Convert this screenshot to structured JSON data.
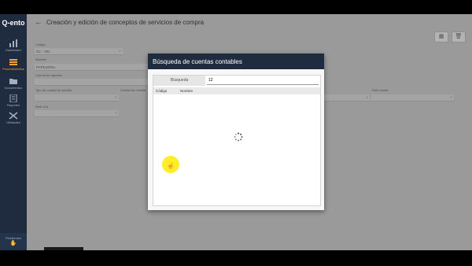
{
  "sidebar": {
    "logo": "Q-ento",
    "items": [
      {
        "label": "Dashboard",
        "icon": "bar-chart-icon",
        "active": false
      },
      {
        "label": "Procedimientos",
        "icon": "stack-icon",
        "active": true
      },
      {
        "label": "Documentos",
        "icon": "folder-icon",
        "active": false
      },
      {
        "label": "Reportes",
        "icon": "report-icon",
        "active": false
      },
      {
        "label": "Utilidades",
        "icon": "tools-icon",
        "active": false
      }
    ],
    "bottom_label": "Pendientes"
  },
  "header": {
    "title": "Creación y edición de conceptos de servicios de compra",
    "back_icon": "back-arrow-icon"
  },
  "form": {
    "codigo_label": "Código",
    "codigo_value": "SC - 001",
    "nombre_label": "Nombre",
    "nombre_value": "PAPELERIA",
    "cuenta_label": "Cuenta de egresos",
    "tipo_label": "Tipo de unidad de medida",
    "unidad_label": "Unidad de medida",
    "rete_fuente_label": "Rete fuente",
    "rete_ica_label": "Rete ICA"
  },
  "dialog": {
    "title": "Búsqueda de cuentas contables",
    "search_label": "Búsqueda",
    "search_value": "12",
    "columns": [
      "Código",
      "Nombre"
    ]
  },
  "colors": {
    "sidebar_bg": "#1f2c3f",
    "accent": "#f2a23a",
    "cursor_highlight": "#ffeb00"
  }
}
